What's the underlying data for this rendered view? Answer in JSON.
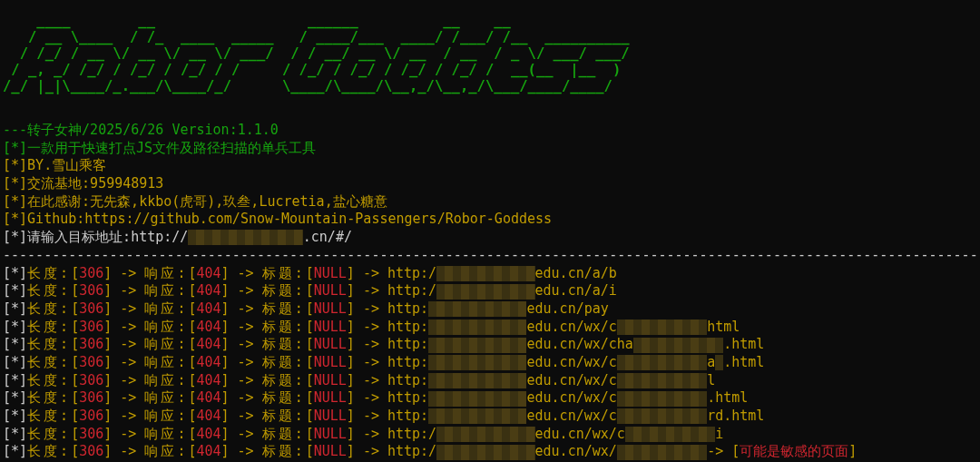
{
  "banner": [
    "    ____        __                  ______          __    __",
    "   / __ \\____  / /_  ____  _____   / ____/___  ____/ /___/ /__  __________",
    "  / /_/ / __ \\/ __ \\/ __ \\/ ___/  / / __/ __ \\/ __  / __  / _ \\/ ___/ ___/",
    " / _, _/ /_/ / /_/ / /_/ / /     / /_/ / /_/ / /_/ / /_/ /  __(__  |__  )",
    "/_/ |_|\\____/_.___/\\____/_/      \\____/\\____/\\__,_/\\__,_/\\___/____/____/"
  ],
  "info_lines": [
    {
      "kind": "green",
      "text": "---转子女神/2025/6/26 Version:1.1.0"
    },
    {
      "kind": "green",
      "text": "[*]一款用于快速打点JS文件及路径扫描的单兵工具"
    },
    {
      "kind": "yellow",
      "text": "[*]BY.雪山乘客"
    },
    {
      "kind": "yellow",
      "text": "[*]交流基地:959948913"
    },
    {
      "kind": "yellow",
      "text": "[*]在此感谢:无先森,kkbo(虎哥),玖叁,Lucretia,盐心糖意"
    },
    {
      "kind": "yellow",
      "text": "[*]Github:https://github.com/Snow-Mountain-Passengers/Robor-Goddess"
    }
  ],
  "prompt": {
    "label": "[*]请输入目标地址:",
    "value_start": "http://",
    "value_end": ".cn/#/"
  },
  "separator": "-----------------------------------------------------------------------------------------------------------------------",
  "rows": [
    {
      "prefix": "[*]",
      "length_label": "长度:",
      "open": "[",
      "close": "]",
      "length": "306",
      "status_label": "响应:",
      "status": "404",
      "title_label": "标题:",
      "title": "NULL",
      "arrow": "->",
      "url": [
        {
          "kind": "text",
          "text": "http:/"
        },
        {
          "kind": "mosaic_wide"
        },
        {
          "kind": "text",
          "text": "edu.cn/a/b"
        }
      ]
    },
    {
      "prefix": "[*]",
      "length_label": "长度:",
      "open": "[",
      "close": "]",
      "length": "306",
      "status_label": "响应:",
      "status": "404",
      "title_label": "标题:",
      "title": "NULL",
      "arrow": "->",
      "url": [
        {
          "kind": "text",
          "text": "http:/"
        },
        {
          "kind": "mosaic_wide"
        },
        {
          "kind": "text",
          "text": "edu.cn/a/i"
        }
      ]
    },
    {
      "prefix": "[*]",
      "length_label": "长度:",
      "open": "[",
      "close": "]",
      "length": "306",
      "status_label": "响应:",
      "status": "404",
      "title_label": "标题:",
      "title": "NULL",
      "arrow": "->",
      "url": [
        {
          "kind": "text",
          "text": "http:"
        },
        {
          "kind": "mosaic_wide"
        },
        {
          "kind": "text",
          "text": "edu.cn/pay"
        }
      ]
    },
    {
      "prefix": "[*]",
      "length_label": "长度:",
      "open": "[",
      "close": "]",
      "length": "306",
      "status_label": "响应:",
      "status": "404",
      "title_label": "标题:",
      "title": "NULL",
      "arrow": "->",
      "url": [
        {
          "kind": "text",
          "text": "http:"
        },
        {
          "kind": "mosaic_wide"
        },
        {
          "kind": "text",
          "text": "edu.cn/wx/c"
        },
        {
          "kind": "mosaic"
        },
        {
          "kind": "text",
          "text": "html"
        }
      ]
    },
    {
      "prefix": "[*]",
      "length_label": "长度:",
      "open": "[",
      "close": "]",
      "length": "306",
      "status_label": "响应:",
      "status": "404",
      "title_label": "标题:",
      "title": "NULL",
      "arrow": "->",
      "url": [
        {
          "kind": "text",
          "text": "http:"
        },
        {
          "kind": "mosaic_wide"
        },
        {
          "kind": "text",
          "text": "edu.cn/wx/cha"
        },
        {
          "kind": "mosaic"
        },
        {
          "kind": "text",
          "text": ".html"
        }
      ]
    },
    {
      "prefix": "[*]",
      "length_label": "长度:",
      "open": "[",
      "close": "]",
      "length": "306",
      "status_label": "响应:",
      "status": "404",
      "title_label": "标题:",
      "title": "NULL",
      "arrow": "->",
      "url": [
        {
          "kind": "text",
          "text": "http:"
        },
        {
          "kind": "mosaic_wide"
        },
        {
          "kind": "text",
          "text": "edu.cn/wx/c"
        },
        {
          "kind": "mosaic"
        },
        {
          "kind": "text",
          "text": "a"
        },
        {
          "kind": "mosaic_narrow"
        },
        {
          "kind": "text",
          "text": ".html"
        }
      ]
    },
    {
      "prefix": "[*]",
      "length_label": "长度:",
      "open": "[",
      "close": "]",
      "length": "306",
      "status_label": "响应:",
      "status": "404",
      "title_label": "标题:",
      "title": "NULL",
      "arrow": "->",
      "url": [
        {
          "kind": "text",
          "text": "http:"
        },
        {
          "kind": "mosaic_wide"
        },
        {
          "kind": "text",
          "text": "edu.cn/wx/c"
        },
        {
          "kind": "mosaic"
        },
        {
          "kind": "text",
          "text": "l"
        }
      ]
    },
    {
      "prefix": "[*]",
      "length_label": "长度:",
      "open": "[",
      "close": "]",
      "length": "306",
      "status_label": "响应:",
      "status": "404",
      "title_label": "标题:",
      "title": "NULL",
      "arrow": "->",
      "url": [
        {
          "kind": "text",
          "text": "http:"
        },
        {
          "kind": "mosaic_wide"
        },
        {
          "kind": "text",
          "text": "edu.cn/wx/c"
        },
        {
          "kind": "mosaic"
        },
        {
          "kind": "text",
          "text": ".html"
        }
      ]
    },
    {
      "prefix": "[*]",
      "length_label": "长度:",
      "open": "[",
      "close": "]",
      "length": "306",
      "status_label": "响应:",
      "status": "404",
      "title_label": "标题:",
      "title": "NULL",
      "arrow": "->",
      "url": [
        {
          "kind": "text",
          "text": "http:"
        },
        {
          "kind": "mosaic_wide"
        },
        {
          "kind": "text",
          "text": "edu.cn/wx/c"
        },
        {
          "kind": "mosaic"
        },
        {
          "kind": "text",
          "text": "rd.html"
        }
      ]
    },
    {
      "prefix": "[*]",
      "length_label": "长度:",
      "open": "[",
      "close": "]",
      "length": "306",
      "status_label": "响应:",
      "status": "404",
      "title_label": "标题:",
      "title": "NULL",
      "arrow": "->",
      "url": [
        {
          "kind": "text",
          "text": "http:/"
        },
        {
          "kind": "mosaic_wide"
        },
        {
          "kind": "text",
          "text": "edu.cn/wx/c"
        },
        {
          "kind": "mosaic"
        },
        {
          "kind": "text",
          "text": "i"
        }
      ]
    },
    {
      "prefix": "[*]",
      "length_label": "长度:",
      "open": "[",
      "close": "]",
      "length": "306",
      "status_label": "响应:",
      "status": "404",
      "title_label": "标题:",
      "title": "NULL",
      "arrow": "->",
      "url": [
        {
          "kind": "text",
          "text": "http:/"
        },
        {
          "kind": "mosaic_wide"
        },
        {
          "kind": "text",
          "text": "edu.cn/wx/"
        },
        {
          "kind": "mosaic"
        },
        {
          "kind": "text",
          "text": "->"
        },
        {
          "kind": "flag",
          "open": "[",
          "close": "]",
          "text": "可能是敏感的页面"
        }
      ]
    }
  ]
}
